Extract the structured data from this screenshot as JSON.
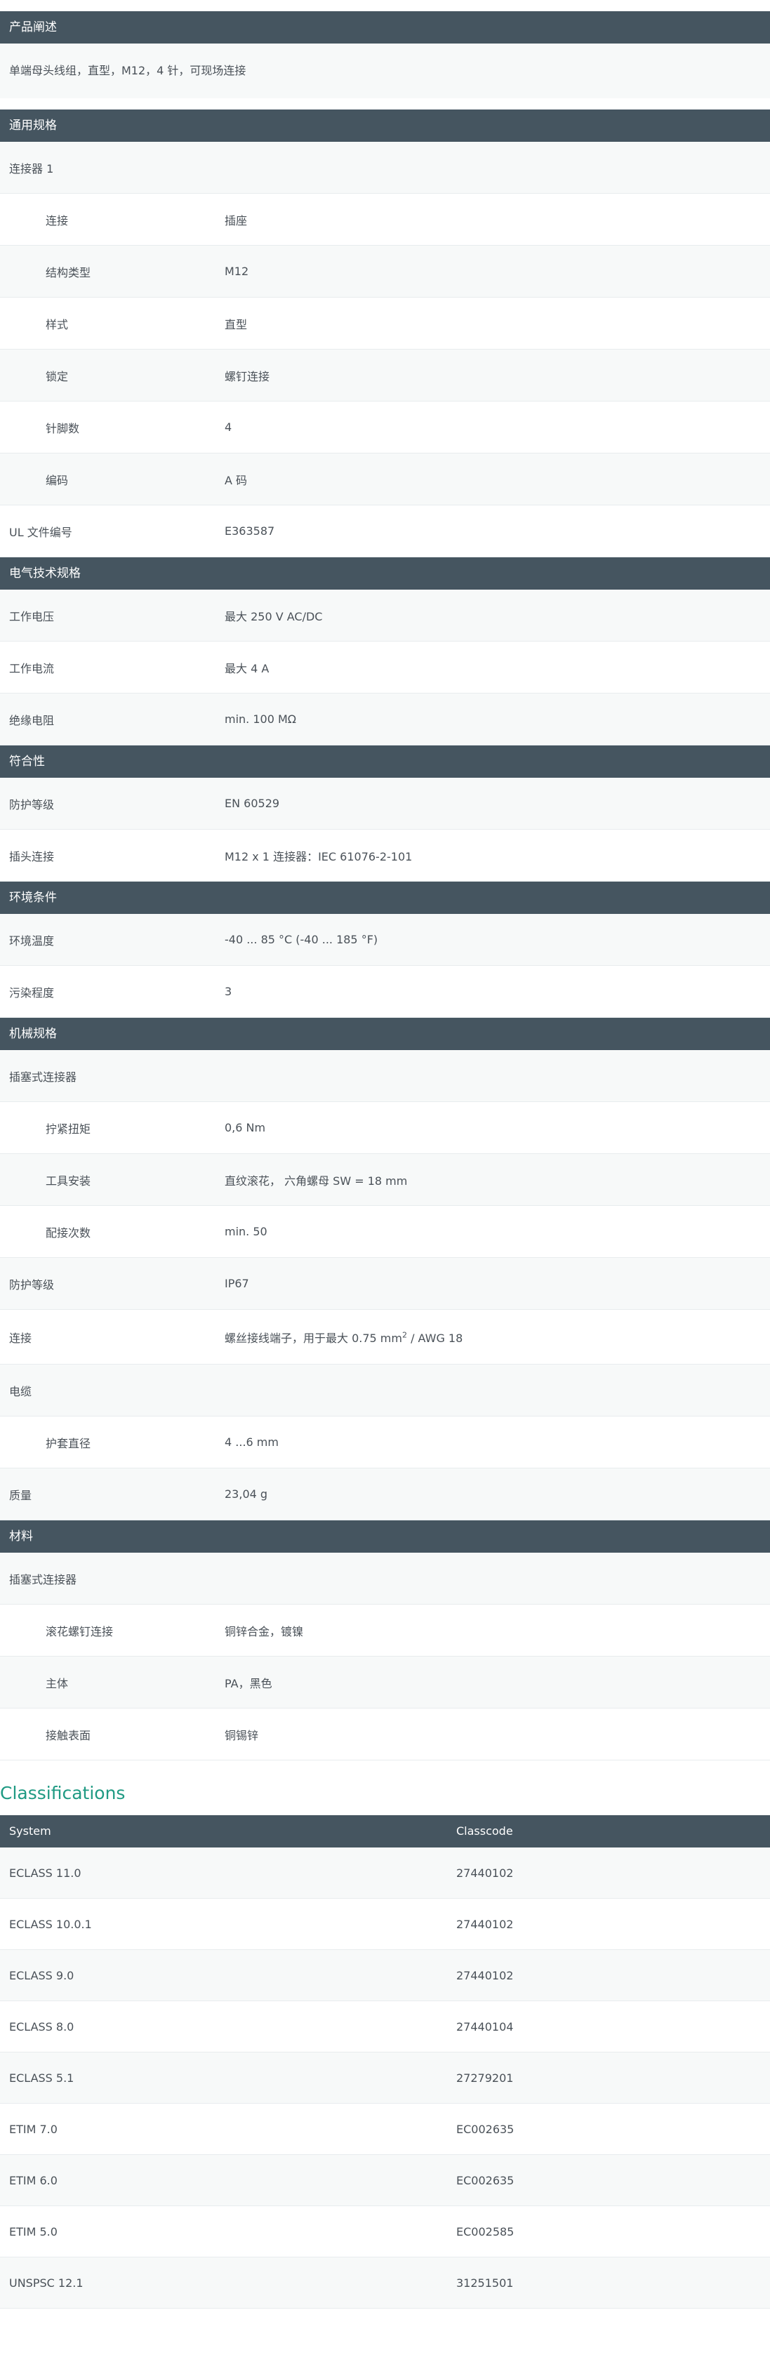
{
  "product_description": {
    "header": "产品阐述",
    "text": "单端母头线组，直型，M12，4 针，可现场连接"
  },
  "general": {
    "header": "通用规格",
    "connector_group": "连接器 1",
    "rows": [
      {
        "label": "连接",
        "value": "插座"
      },
      {
        "label": "结构类型",
        "value": "M12"
      },
      {
        "label": "样式",
        "value": "直型"
      },
      {
        "label": "锁定",
        "value": "螺钉连接"
      },
      {
        "label": "针脚数",
        "value": "4"
      },
      {
        "label": "编码",
        "value": "A 码"
      }
    ],
    "ul_label": "UL 文件编号",
    "ul_value": "E363587"
  },
  "electrical": {
    "header": "电气技术规格",
    "rows": [
      {
        "label": "工作电压",
        "value": "最大 250 V AC/DC"
      },
      {
        "label": "工作电流",
        "value": "最大 4 A"
      },
      {
        "label": "绝缘电阻",
        "value": "min. 100 MΩ"
      }
    ]
  },
  "compliance": {
    "header": "符合性",
    "rows": [
      {
        "label": "防护等级",
        "value": "EN 60529"
      },
      {
        "label": "插头连接",
        "value": "M12 x 1 连接器：IEC 61076-2-101"
      }
    ]
  },
  "environment": {
    "header": "环境条件",
    "rows": [
      {
        "label": "环境温度",
        "value": "-40 ... 85 °C (-40 ... 185 °F)"
      },
      {
        "label": "污染程度",
        "value": "3"
      }
    ]
  },
  "mechanical": {
    "header": "机械规格",
    "plug_group": "插塞式连接器",
    "plug_rows": [
      {
        "label": "拧紧扭矩",
        "value": "0,6 Nm"
      },
      {
        "label": "工具安装",
        "value": "直纹滚花， 六角螺母 SW = 18 mm"
      },
      {
        "label": "配接次数",
        "value": "min. 50"
      }
    ],
    "protection_label": "防护等级",
    "protection_value": "IP67",
    "connection_label": "连接",
    "connection_value_a": "螺丝接线端子，用于最大 0.75 mm",
    "connection_value_sup": "2",
    "connection_value_b": " / AWG 18",
    "cable_group": "电缆",
    "cable_rows": [
      {
        "label": "护套直径",
        "value": "4 ...6 mm"
      }
    ],
    "mass_label": "质量",
    "mass_value": "23,04 g"
  },
  "material": {
    "header": "材料",
    "plug_group": "插塞式连接器",
    "rows": [
      {
        "label": "滚花螺钉连接",
        "value": "铜锌合金，镀镍"
      },
      {
        "label": "主体",
        "value": "PA，黑色"
      },
      {
        "label": "接触表面",
        "value": "铜锡锌"
      }
    ]
  },
  "classifications": {
    "title": "Classifications",
    "col_system": "System",
    "col_classcode": "Classcode",
    "rows": [
      {
        "system": "ECLASS 11.0",
        "code": "27440102"
      },
      {
        "system": "ECLASS 10.0.1",
        "code": "27440102"
      },
      {
        "system": "ECLASS 9.0",
        "code": "27440102"
      },
      {
        "system": "ECLASS 8.0",
        "code": "27440104"
      },
      {
        "system": "ECLASS 5.1",
        "code": "27279201"
      },
      {
        "system": "ETIM 7.0",
        "code": "EC002635"
      },
      {
        "system": "ETIM 6.0",
        "code": "EC002635"
      },
      {
        "system": "ETIM 5.0",
        "code": "EC002585"
      },
      {
        "system": "UNSPSC 12.1",
        "code": "31251501"
      }
    ]
  },
  "colors": {
    "header_bg": "#455560",
    "row_alt_bg": "#f7f9f9",
    "accent": "#1f9a83"
  }
}
